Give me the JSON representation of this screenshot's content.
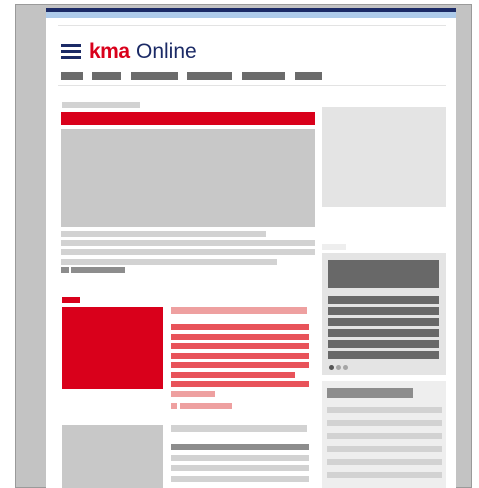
{
  "brand": {
    "logo_part1": "kma",
    "logo_part2": "Online",
    "accent_red": "#d9001b",
    "navy": "#1b2a66"
  },
  "nav": {
    "item_count": 6
  },
  "carousel": {
    "slide_count": 3,
    "active_slide": 1
  }
}
